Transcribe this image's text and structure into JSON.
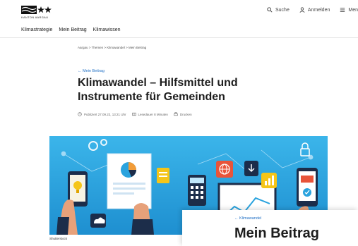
{
  "header": {
    "logo_text": "KANTON AARGAU",
    "search_label": "Suche",
    "login_label": "Anmelden",
    "menu_label": "Men"
  },
  "subnav": {
    "items": [
      "Klimastrategie",
      "Mein Beitrag",
      "Klimawissen"
    ]
  },
  "breadcrumb": {
    "items": [
      "Aargau",
      "Themen",
      "Klimawandel",
      "Mein Beitrag"
    ],
    "separator": ">"
  },
  "article": {
    "back_link": "← Mein Beitrag",
    "title_line1": "Klimawandel – Hilfsmittel und",
    "title_line2": "Instrumente für Gemeinden",
    "published": "Publiziert 27.09.22, 13:21 Uhr",
    "reading_time": "Lesedauer 8 Minuten",
    "print_label": "Drucken"
  },
  "hero": {
    "caption": "Shutterstock",
    "background_color": "#2aa3de"
  },
  "overlay": {
    "back_link": "← Klimawandel",
    "title": "Mein Beitrag"
  },
  "colors": {
    "link": "#1f6fc5",
    "text": "#1d1d1d"
  }
}
